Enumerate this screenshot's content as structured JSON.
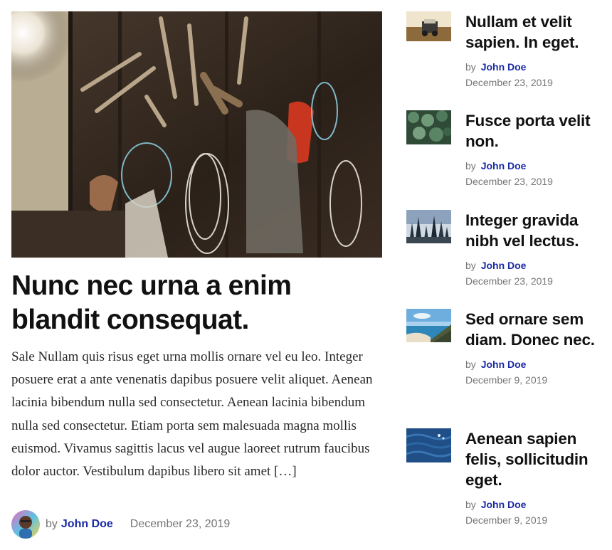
{
  "featured": {
    "title": "Nunc nec urna a enim blandit consequat.",
    "excerpt": "Sale Nullam quis risus eget urna mollis ornare vel eu leo. Integer posuere erat a ante venenatis dapibus posuere velit aliquet. Aenean lacinia bibendum nulla sed consectetur. Aenean lacinia bibendum nulla sed consectetur. Etiam porta sem malesuada magna mollis euismod. Vivamus sagittis lacus vel augue laoreet rutrum faucibus dolor auctor. Vestibulum dapibus libero sit amet […]",
    "by_label": "by",
    "author": "John Doe",
    "date": "December 23, 2019"
  },
  "sidebar": {
    "posts": [
      {
        "title": "Nullam et velit sapien. In eget.",
        "by_label": "by",
        "author": "John Doe",
        "date": "December 23, 2019"
      },
      {
        "title": "Fusce porta velit non.",
        "by_label": "by",
        "author": "John Doe",
        "date": "December 23, 2019"
      },
      {
        "title": "Integer gravida nibh vel lectus.",
        "by_label": "by",
        "author": "John Doe",
        "date": "December 23, 2019"
      },
      {
        "title": "Sed ornare sem diam. Donec nec.",
        "by_label": "by",
        "author": "John Doe",
        "date": "December 9, 2019"
      },
      {
        "title": "Aenean sapien felis, sollicitudin eget.",
        "by_label": "by",
        "author": "John Doe",
        "date": "December 9, 2019"
      }
    ]
  },
  "colors": {
    "author_link": "#1a2ba4",
    "meta_text": "#767676",
    "title_text": "#111111"
  }
}
